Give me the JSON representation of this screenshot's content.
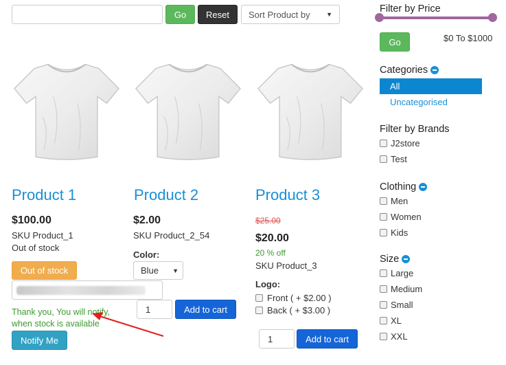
{
  "toolbar": {
    "search_value": "",
    "go_label": "Go",
    "reset_label": "Reset",
    "sort_label": "Sort Product by"
  },
  "products": [
    {
      "title": "Product 1",
      "price": "$100.00",
      "sku": "SKU Product_1",
      "stock": "Out of stock",
      "stock_button": "Out of stock",
      "notify_message": "Thank you, You will notify, when stock is available",
      "notify_button": "Notify Me"
    },
    {
      "title": "Product 2",
      "price": "$2.00",
      "sku": "SKU Product_2_54",
      "color_label": "Color:",
      "color_value": "Blue",
      "qty": "1",
      "cart_button": "Add to cart"
    },
    {
      "title": "Product 3",
      "old_price": "$25.00",
      "price": "$20.00",
      "discount": "20 % off",
      "sku": "SKU Product_3",
      "logo_label": "Logo:",
      "logo_options": [
        "Front ( + $2.00 )",
        "Back ( + $3.00 )"
      ],
      "qty": "1",
      "cart_button": "Add to cart"
    }
  ],
  "sidebar": {
    "price_heading": "Filter by Price",
    "price_go": "Go",
    "price_range": "$0 To $1000",
    "categories_heading": "Categories",
    "categories": [
      "All",
      "Uncategorised"
    ],
    "brands_heading": "Filter by Brands",
    "brands": [
      "J2store",
      "Test"
    ],
    "clothing_heading": "Clothing",
    "clothing": [
      "Men",
      "Women",
      "Kids"
    ],
    "size_heading": "Size",
    "sizes": [
      "Large",
      "Medium",
      "Small",
      "XL",
      "XXL"
    ]
  },
  "colors": {
    "link": "#1a8fd6",
    "go_green": "#5cb85c",
    "out_of_stock_orange": "#f0ad4e",
    "notify_teal": "#31a2c4",
    "cart_blue": "#1565d8",
    "slider_purple": "#a066a0",
    "annotation_arrow": "#e02020"
  }
}
